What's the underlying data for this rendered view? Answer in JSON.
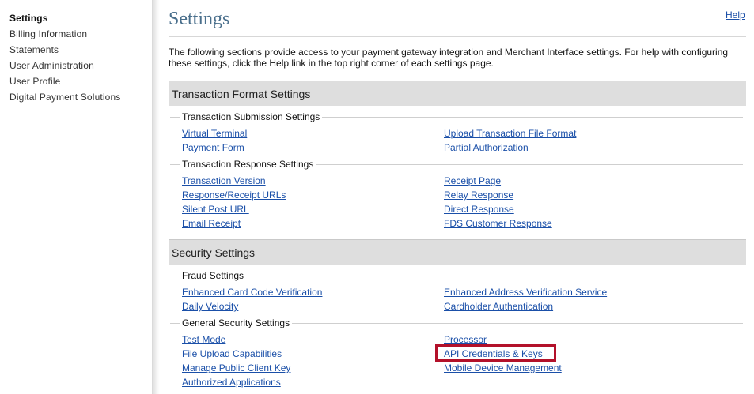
{
  "sidebar": {
    "items": [
      {
        "label": "Settings",
        "active": true
      },
      {
        "label": "Billing Information"
      },
      {
        "label": "Statements"
      },
      {
        "label": "User Administration"
      },
      {
        "label": "User Profile"
      },
      {
        "label": "Digital Payment Solutions"
      }
    ]
  },
  "header": {
    "title": "Settings",
    "help_label": "Help"
  },
  "intro": "The following sections provide access to your payment gateway integration and Merchant Interface settings. For help with configuring these settings, click the Help link in the top right corner of each settings page.",
  "sections": [
    {
      "title": "Transaction Format Settings",
      "groups": [
        {
          "label": "Transaction Submission Settings",
          "left": [
            "Virtual Terminal",
            "Payment Form"
          ],
          "right": [
            "Upload Transaction File Format",
            "Partial Authorization"
          ]
        },
        {
          "label": "Transaction Response Settings",
          "left": [
            "Transaction Version",
            "Response/Receipt URLs",
            "Silent Post URL",
            "Email Receipt"
          ],
          "right": [
            "Receipt Page",
            "Relay Response",
            "Direct Response",
            "FDS Customer Response"
          ]
        }
      ]
    },
    {
      "title": "Security Settings",
      "groups": [
        {
          "label": "Fraud Settings",
          "left": [
            "Enhanced Card Code Verification",
            "Daily Velocity"
          ],
          "right": [
            "Enhanced Address Verification Service",
            "Cardholder Authentication"
          ]
        },
        {
          "label": "General Security Settings",
          "left": [
            "Test Mode",
            "File Upload Capabilities",
            "Manage Public Client Key",
            "Authorized Applications"
          ],
          "right": [
            "Processor",
            "API Credentials & Keys",
            "Mobile Device Management"
          ]
        }
      ]
    }
  ],
  "colors": {
    "link": "#1a4fa8",
    "title": "#4a6f8c",
    "section_header_bg": "#dedede",
    "highlight": "#b3112a"
  }
}
